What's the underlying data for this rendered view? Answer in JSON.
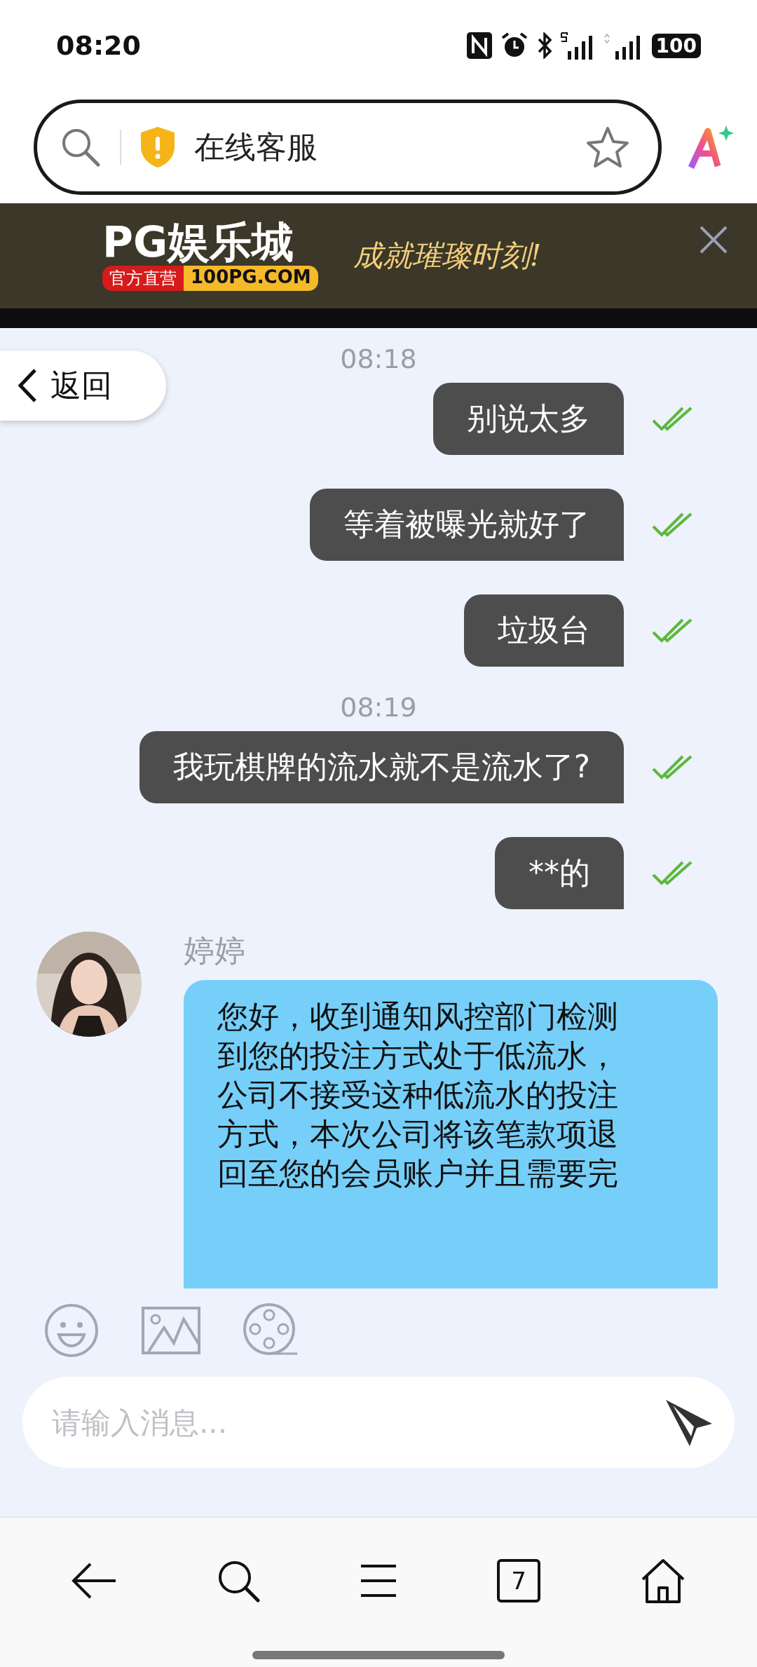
{
  "status_bar": {
    "time": "08:20",
    "battery": "100"
  },
  "address_bar": {
    "title": "在线客服",
    "bookmarked": false
  },
  "ad_banner": {
    "brand": "PG娱乐城",
    "tag": "官方直营",
    "site": "100PG.COM",
    "slogan": "成就璀璨时刻!"
  },
  "back_button": {
    "label": "返回"
  },
  "messages": [
    {
      "kind": "time",
      "text": "08:18"
    },
    {
      "kind": "sent",
      "text": "别说太多",
      "read": true
    },
    {
      "kind": "sent",
      "text": "等着被曝光就好了",
      "read": true
    },
    {
      "kind": "sent",
      "text": "垃圾台",
      "read": true
    },
    {
      "kind": "time",
      "text": "08:19"
    },
    {
      "kind": "sent",
      "text": "我玩棋牌的流水就不是流水了?",
      "read": true
    },
    {
      "kind": "sent",
      "text": "**的",
      "read": true
    },
    {
      "kind": "received",
      "sender": "婷婷",
      "text": "您好，收到通知风控部门检测到您的投注方式处于低流水，公司不接受这种低流水的投注方式，本次公司将该笔款项退回至您的会员账户并且需要完"
    }
  ],
  "composer": {
    "placeholder": "请输入消息..."
  },
  "bottom_nav": {
    "tab_count": "7"
  }
}
